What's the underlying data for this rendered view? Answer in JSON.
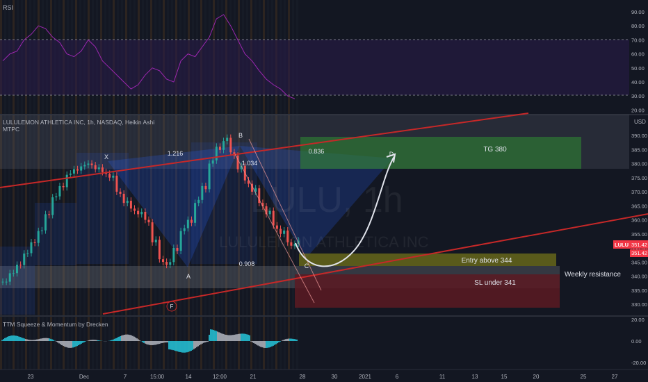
{
  "rsi_panel": {
    "title": "RSI",
    "ticks": [
      "90.00",
      "80.00",
      "70.00",
      "60.00",
      "50.00",
      "40.00",
      "30.00",
      "20.00"
    ]
  },
  "main_panel": {
    "title": "LULULEMON ATHLETICA INC, 1h, NASDAQ, Heikin Ashi",
    "indicator": "MTPC",
    "currency": "USD",
    "watermark_symbol": "LULU, 1h",
    "watermark_name": "LULULEMON ATHLETICA INC",
    "price_ticks": [
      "390.00",
      "385.00",
      "380.00",
      "375.00",
      "370.00",
      "365.00",
      "360.00",
      "355.00",
      "350.00",
      "345.00",
      "340.00",
      "335.00",
      "330.00"
    ],
    "price_tag_symbol": "LULU",
    "price_tag_value": "351.42",
    "price_tag_value_2": "351.42",
    "price_tag_color": "#f23645"
  },
  "annotations": {
    "pattern_points": [
      "X",
      "A",
      "B",
      "C",
      "D",
      "F"
    ],
    "ratios": [
      "1.216",
      "1.034",
      "0.836",
      "0.908"
    ],
    "target_box": "TG 380",
    "entry_box": "Entry above 344",
    "sl_box": "SL under 341",
    "resistance_label": "Weekly resistance",
    "colors": {
      "target": "#2e7d32",
      "entry": "#6b6b1a",
      "stop": "#5c1a22",
      "trendline": "#c62828"
    }
  },
  "momentum_panel": {
    "title": "TTM Squeeze & Momentum by Drecken",
    "ticks": [
      "20.00",
      "0.00",
      "-20.00"
    ]
  },
  "time_axis": [
    "23",
    "Dec",
    "7",
    "15:00",
    "14",
    "12:00",
    "21",
    "28",
    "30",
    "2021",
    "6",
    "11",
    "13",
    "15",
    "20",
    "25",
    "27"
  ],
  "chart_data": {
    "type": "candlestick",
    "series": [
      {
        "name": "Heikin Ashi close (approx.)",
        "values": [
          338,
          341,
          344,
          348,
          352,
          356,
          362,
          368,
          372,
          376,
          378,
          379,
          380,
          378,
          377,
          375,
          370,
          366,
          364,
          362,
          360,
          352,
          346,
          344,
          350,
          356,
          360,
          366,
          372,
          380,
          386,
          388,
          384,
          378,
          374,
          370,
          366,
          362,
          358,
          355,
          352,
          351.42
        ]
      }
    ],
    "ylim": [
      328,
      393
    ],
    "rsi_ylim": [
      15,
      95
    ]
  }
}
